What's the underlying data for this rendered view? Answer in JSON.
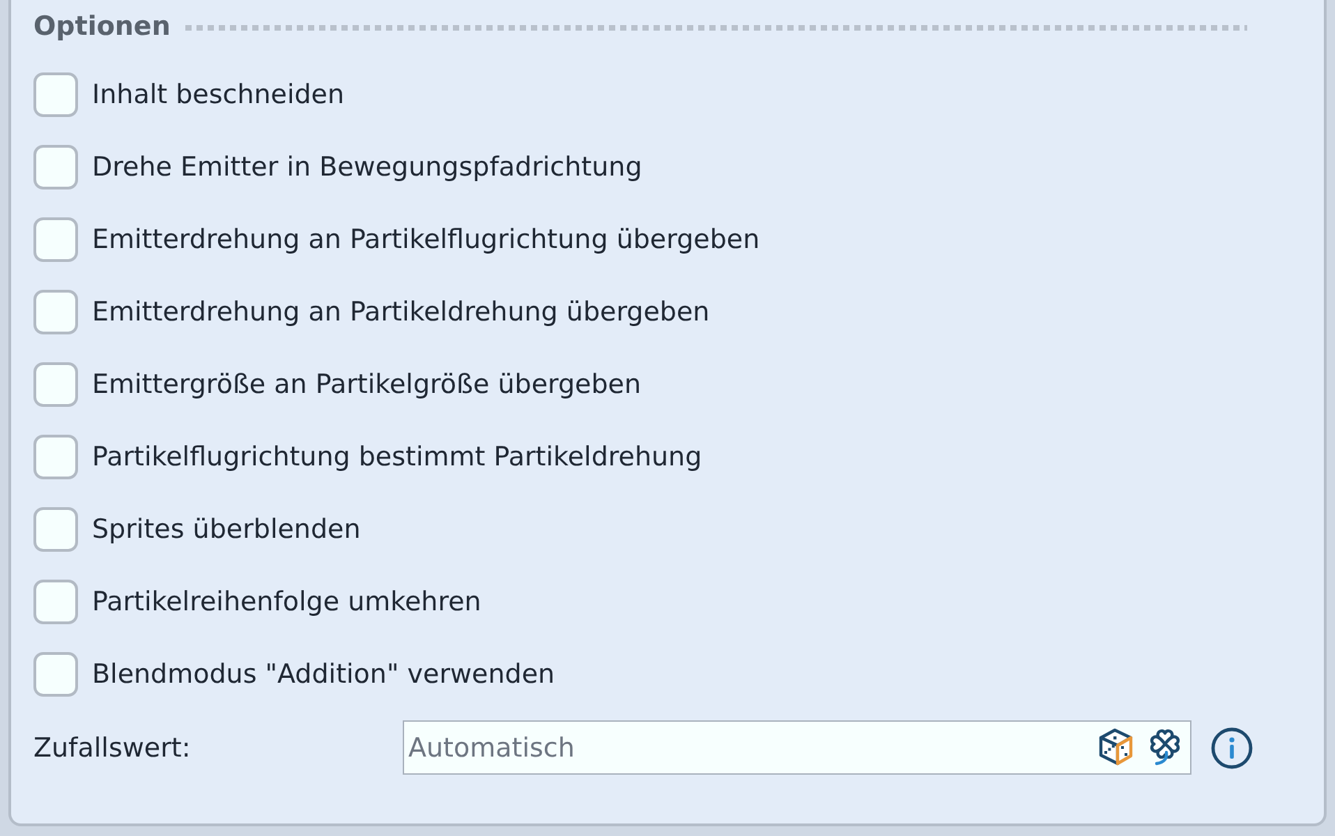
{
  "section": {
    "title": "Optionen"
  },
  "options": [
    {
      "label": "Inhalt beschneiden",
      "checked": false
    },
    {
      "label": "Drehe Emitter in Bewegungspfadrichtung",
      "checked": false
    },
    {
      "label": "Emitterdrehung an Partikelflugrichtung übergeben",
      "checked": false
    },
    {
      "label": "Emitterdrehung an Partikeldrehung übergeben",
      "checked": false
    },
    {
      "label": "Emittergröße an Partikelgröße übergeben",
      "checked": false
    },
    {
      "label": "Partikelflugrichtung bestimmt Partikeldrehung",
      "checked": false
    },
    {
      "label": "Sprites überblenden",
      "checked": false
    },
    {
      "label": "Partikelreihenfolge umkehren",
      "checked": false
    },
    {
      "label": "Blendmodus \"Addition\" verwenden",
      "checked": false
    }
  ],
  "random_seed": {
    "label": "Zufallswert:",
    "placeholder": "Automatisch"
  }
}
